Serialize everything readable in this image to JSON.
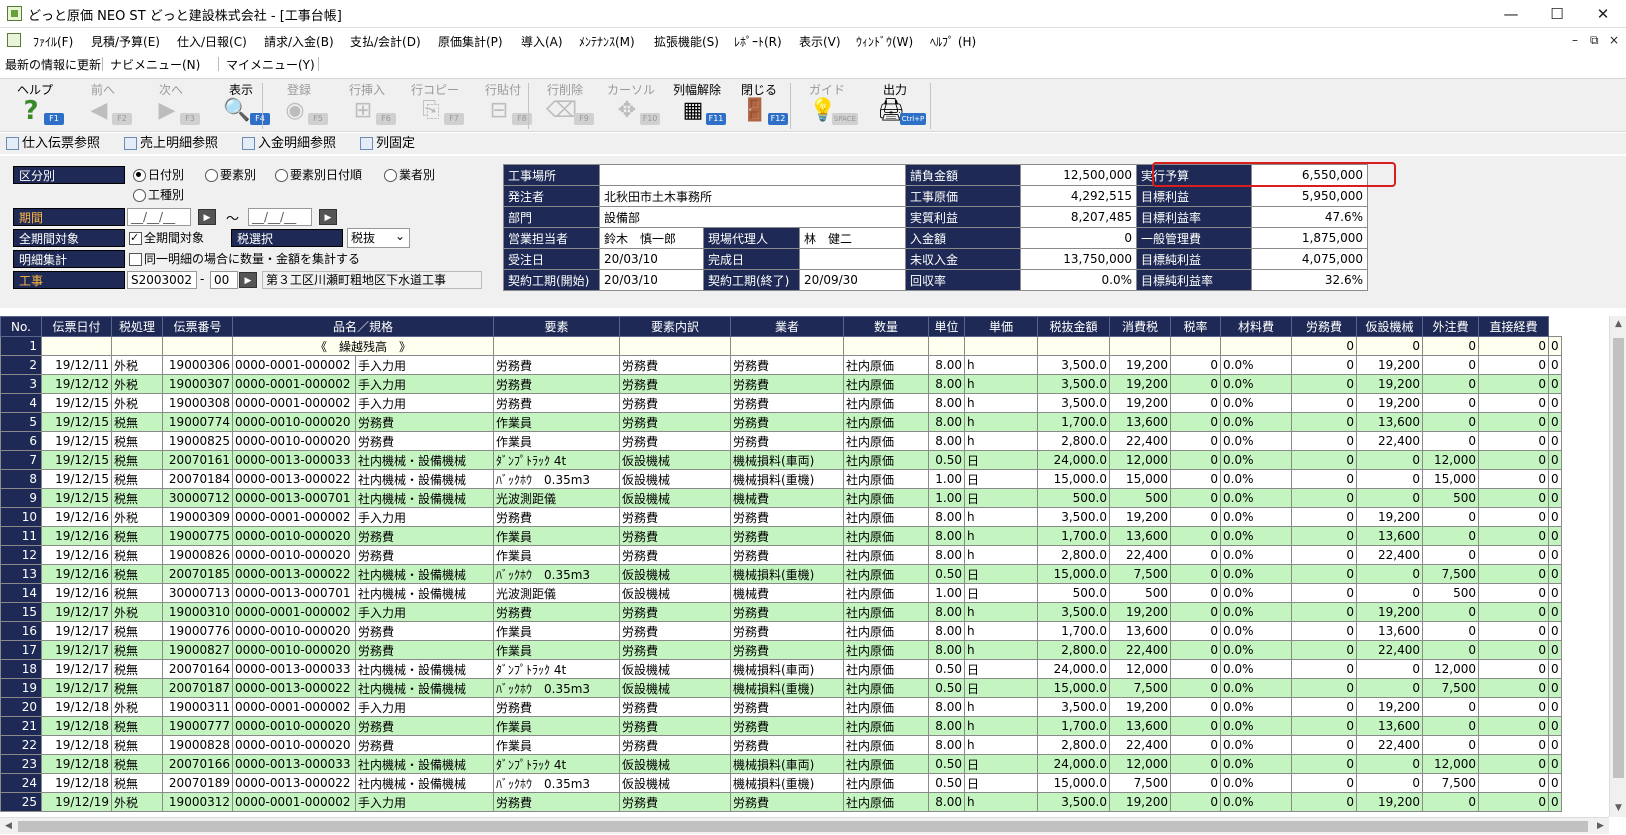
{
  "window": {
    "title": "どっと原価 NEO ST どっと建設株式会社 - [工事台帳]",
    "minimize": "—",
    "maximize": "☐",
    "close": "✕"
  },
  "menubar": {
    "items": [
      "ﾌｧｲﾙ(F)",
      "見積/予算(E)",
      "仕入/日報(C)",
      "請求/入金(B)",
      "支払/会計(D)",
      "原価集計(P)",
      "導入(A)",
      "ﾒﾝﾃﾅﾝｽ(M)",
      "拡張機能(S)",
      "ﾚﾎﾟｰﾄ(R)",
      "表示(V)",
      "ｳｨﾝﾄﾞｳ(W)",
      "ﾍﾙﾌﾟ (H)"
    ],
    "mdi_min": "–",
    "mdi_restore": "⧉",
    "mdi_close": "×"
  },
  "linkbar": {
    "items": [
      "最新の情報に更新",
      "ナビメニュー(N)",
      "マイメニュー(Y)"
    ]
  },
  "toolbar": {
    "buttons": [
      {
        "label": "ヘルプ",
        "key": "F1",
        "icon": "help-icon",
        "glyph": "?",
        "enabled": true
      },
      {
        "label": "前へ",
        "key": "F2",
        "icon": "back-arrow-icon",
        "glyph": "◀",
        "enabled": false
      },
      {
        "label": "次へ",
        "key": "F3",
        "icon": "forward-arrow-icon",
        "glyph": "▶",
        "enabled": false
      },
      {
        "label": "表示",
        "key": "F4",
        "icon": "magnifier-icon",
        "glyph": "🔍",
        "enabled": true
      },
      {
        "label": "登録",
        "key": "F5",
        "icon": "ok-icon",
        "glyph": "◉",
        "enabled": false
      },
      {
        "label": "行挿入",
        "key": "F6",
        "icon": "row-insert-icon",
        "glyph": "⊞",
        "enabled": false
      },
      {
        "label": "行コピー",
        "key": "F7",
        "icon": "row-copy-icon",
        "glyph": "⎘",
        "enabled": false
      },
      {
        "label": "行貼付",
        "key": "F8",
        "icon": "row-paste-icon",
        "glyph": "⊟",
        "enabled": false
      },
      {
        "label": "行削除",
        "key": "F9",
        "icon": "row-delete-icon",
        "glyph": "⌫",
        "enabled": false
      },
      {
        "label": "カーソル",
        "key": "F10",
        "icon": "cursor-icon",
        "glyph": "✥",
        "enabled": false
      },
      {
        "label": "列幅解除",
        "key": "F11",
        "icon": "column-width-icon",
        "glyph": "▦",
        "enabled": true
      },
      {
        "label": "閉じる",
        "key": "F12",
        "icon": "door-icon",
        "glyph": "🚪",
        "enabled": true
      },
      {
        "label": "ガイド",
        "key": "SPACE",
        "icon": "lightbulb-icon",
        "glyph": "💡",
        "enabled": false
      },
      {
        "label": "出力",
        "key": "Ctrl+P",
        "icon": "print-output-icon",
        "glyph": "🖨",
        "enabled": true
      }
    ]
  },
  "refbar": {
    "items": [
      "仕入伝票参照",
      "売上明細参照",
      "入金明細参照",
      "列固定"
    ]
  },
  "filter": {
    "kubun_label": "区分別",
    "kubun_options": [
      "日付別",
      "要素別",
      "要素別日付順",
      "業者別",
      "工種別"
    ],
    "kubun_selected": "日付別",
    "kikan_label": "期間",
    "date_placeholder": "__/__/__",
    "tilde": "～",
    "zenkikan_label": "全期間対象",
    "zenkikan_check": "全期間対象",
    "zei_select_label": "税選択",
    "zei_select_value": "税抜",
    "meisai_label": "明細集計",
    "meisai_check": "同一明細の場合に数量・金額を集計する",
    "kouji_label": "工事",
    "kouji_code": "S2003002",
    "kouji_dash": "-",
    "kouji_sub": "00",
    "kouji_name": "第３工区川瀬町粗地区下水道工事"
  },
  "info": {
    "rows": [
      {
        "h1": "工事場所",
        "v1": "",
        "h3": "請負金額",
        "v3": "12,500,000",
        "h4": "実行予算",
        "v4": "6,550,000"
      },
      {
        "h1": "発注者",
        "v1": "北秋田市土木事務所",
        "h3": "工事原価",
        "v3": "4,292,515",
        "h4": "目標利益",
        "v4": "5,950,000"
      },
      {
        "h1": "部門",
        "v1": "設備部",
        "h3": "実質利益",
        "v3": "8,207,485",
        "h4": "目標利益率",
        "v4": "47.6%"
      },
      {
        "h1": "営業担当者",
        "v1": "鈴木　慎一郎",
        "h2": "現場代理人",
        "v2": "林　健二",
        "h3": "入金額",
        "v3": "0",
        "h4": "一般管理費",
        "v4": "1,875,000"
      },
      {
        "h1": "受注日",
        "v1": "20/03/10",
        "h2": "完成日",
        "v2": "",
        "h3": "未収入金",
        "v3": "13,750,000",
        "h4": "目標純利益",
        "v4": "4,075,000"
      },
      {
        "h1": "契約工期(開始)",
        "v1": "20/03/10",
        "h2": "契約工期(終了)",
        "v2": "20/09/30",
        "h3": "回収率",
        "v3": "0.0%",
        "h4": "目標純利益率",
        "v4": "32.6%"
      }
    ]
  },
  "grid": {
    "headers": [
      "No.",
      "伝票日付",
      "税処理",
      "伝票番号",
      "品名／規格",
      "",
      "要素",
      "要素内訳",
      "業者",
      "数量",
      "単位",
      "単価",
      "税抜金額",
      "消費税",
      "税率",
      "材料費",
      "労務費",
      "仮設機械",
      "外注費",
      "直接経費"
    ],
    "carry_over": {
      "no": "1",
      "label": "《　繰越残高　》",
      "zairyo": "0",
      "romu": "0",
      "kasetsu": "0",
      "gaichu": "0",
      "chokusetsu": "0"
    },
    "rows": [
      [
        "2",
        "19/12/11",
        "外税",
        "19000306",
        "0000-0001-000002",
        "手入力用",
        "労務費",
        "労務費",
        "労務費",
        "社内原価",
        "8.00",
        "h",
        "3,500.0",
        "19,200",
        "0",
        "0.0%",
        "0",
        "19,200",
        "0",
        "0",
        "0"
      ],
      [
        "3",
        "19/12/12",
        "外税",
        "19000307",
        "0000-0001-000002",
        "手入力用",
        "労務費",
        "労務費",
        "労務費",
        "社内原価",
        "8.00",
        "h",
        "3,500.0",
        "19,200",
        "0",
        "0.0%",
        "0",
        "19,200",
        "0",
        "0",
        "0"
      ],
      [
        "4",
        "19/12/15",
        "外税",
        "19000308",
        "0000-0001-000002",
        "手入力用",
        "労務費",
        "労務費",
        "労務費",
        "社内原価",
        "8.00",
        "h",
        "3,500.0",
        "19,200",
        "0",
        "0.0%",
        "0",
        "19,200",
        "0",
        "0",
        "0"
      ],
      [
        "5",
        "19/12/15",
        "税無",
        "19000774",
        "0000-0010-000020",
        "労務費",
        "作業員",
        "労務費",
        "労務費",
        "社内原価",
        "8.00",
        "h",
        "1,700.0",
        "13,600",
        "0",
        "0.0%",
        "0",
        "13,600",
        "0",
        "0",
        "0"
      ],
      [
        "6",
        "19/12/15",
        "税無",
        "19000825",
        "0000-0010-000020",
        "労務費",
        "作業員",
        "労務費",
        "労務費",
        "社内原価",
        "8.00",
        "h",
        "2,800.0",
        "22,400",
        "0",
        "0.0%",
        "0",
        "22,400",
        "0",
        "0",
        "0"
      ],
      [
        "7",
        "19/12/15",
        "税無",
        "20070161",
        "0000-0013-000033",
        "社内機械・設備機械",
        "ﾀﾞﾝﾌﾟﾄﾗｯｸ 4t",
        "仮設機械",
        "機械損料(車両)",
        "社内原価",
        "0.50",
        "日",
        "24,000.0",
        "12,000",
        "0",
        "0.0%",
        "0",
        "0",
        "12,000",
        "0",
        "0"
      ],
      [
        "8",
        "19/12/15",
        "税無",
        "20070184",
        "0000-0013-000022",
        "社内機械・設備機械",
        "ﾊﾞｯｸﾎｳ　0.35m3",
        "仮設機械",
        "機械損料(重機)",
        "社内原価",
        "1.00",
        "日",
        "15,000.0",
        "15,000",
        "0",
        "0.0%",
        "0",
        "0",
        "15,000",
        "0",
        "0"
      ],
      [
        "9",
        "19/12/15",
        "税無",
        "30000712",
        "0000-0013-000701",
        "社内機械・設備機械",
        "光波測距儀",
        "仮設機械",
        "機械費",
        "社内原価",
        "1.00",
        "日",
        "500.0",
        "500",
        "0",
        "0.0%",
        "0",
        "0",
        "500",
        "0",
        "0"
      ],
      [
        "10",
        "19/12/16",
        "外税",
        "19000309",
        "0000-0001-000002",
        "手入力用",
        "労務費",
        "労務費",
        "労務費",
        "社内原価",
        "8.00",
        "h",
        "3,500.0",
        "19,200",
        "0",
        "0.0%",
        "0",
        "19,200",
        "0",
        "0",
        "0"
      ],
      [
        "11",
        "19/12/16",
        "税無",
        "19000775",
        "0000-0010-000020",
        "労務費",
        "作業員",
        "労務費",
        "労務費",
        "社内原価",
        "8.00",
        "h",
        "1,700.0",
        "13,600",
        "0",
        "0.0%",
        "0",
        "13,600",
        "0",
        "0",
        "0"
      ],
      [
        "12",
        "19/12/16",
        "税無",
        "19000826",
        "0000-0010-000020",
        "労務費",
        "作業員",
        "労務費",
        "労務費",
        "社内原価",
        "8.00",
        "h",
        "2,800.0",
        "22,400",
        "0",
        "0.0%",
        "0",
        "22,400",
        "0",
        "0",
        "0"
      ],
      [
        "13",
        "19/12/16",
        "税無",
        "20070185",
        "0000-0013-000022",
        "社内機械・設備機械",
        "ﾊﾞｯｸﾎｳ　0.35m3",
        "仮設機械",
        "機械損料(重機)",
        "社内原価",
        "0.50",
        "日",
        "15,000.0",
        "7,500",
        "0",
        "0.0%",
        "0",
        "0",
        "7,500",
        "0",
        "0"
      ],
      [
        "14",
        "19/12/16",
        "税無",
        "30000713",
        "0000-0013-000701",
        "社内機械・設備機械",
        "光波測距儀",
        "仮設機械",
        "機械費",
        "社内原価",
        "1.00",
        "日",
        "500.0",
        "500",
        "0",
        "0.0%",
        "0",
        "0",
        "500",
        "0",
        "0"
      ],
      [
        "15",
        "19/12/17",
        "外税",
        "19000310",
        "0000-0001-000002",
        "手入力用",
        "労務費",
        "労務費",
        "労務費",
        "社内原価",
        "8.00",
        "h",
        "3,500.0",
        "19,200",
        "0",
        "0.0%",
        "0",
        "19,200",
        "0",
        "0",
        "0"
      ],
      [
        "16",
        "19/12/17",
        "税無",
        "19000776",
        "0000-0010-000020",
        "労務費",
        "作業員",
        "労務費",
        "労務費",
        "社内原価",
        "8.00",
        "h",
        "1,700.0",
        "13,600",
        "0",
        "0.0%",
        "0",
        "13,600",
        "0",
        "0",
        "0"
      ],
      [
        "17",
        "19/12/17",
        "税無",
        "19000827",
        "0000-0010-000020",
        "労務費",
        "作業員",
        "労務費",
        "労務費",
        "社内原価",
        "8.00",
        "h",
        "2,800.0",
        "22,400",
        "0",
        "0.0%",
        "0",
        "22,400",
        "0",
        "0",
        "0"
      ],
      [
        "18",
        "19/12/17",
        "税無",
        "20070164",
        "0000-0013-000033",
        "社内機械・設備機械",
        "ﾀﾞﾝﾌﾟﾄﾗｯｸ 4t",
        "仮設機械",
        "機械損料(車両)",
        "社内原価",
        "0.50",
        "日",
        "24,000.0",
        "12,000",
        "0",
        "0.0%",
        "0",
        "0",
        "12,000",
        "0",
        "0"
      ],
      [
        "19",
        "19/12/17",
        "税無",
        "20070187",
        "0000-0013-000022",
        "社内機械・設備機械",
        "ﾊﾞｯｸﾎｳ　0.35m3",
        "仮設機械",
        "機械損料(重機)",
        "社内原価",
        "0.50",
        "日",
        "15,000.0",
        "7,500",
        "0",
        "0.0%",
        "0",
        "0",
        "7,500",
        "0",
        "0"
      ],
      [
        "20",
        "19/12/18",
        "外税",
        "19000311",
        "0000-0001-000002",
        "手入力用",
        "労務費",
        "労務費",
        "労務費",
        "社内原価",
        "8.00",
        "h",
        "3,500.0",
        "19,200",
        "0",
        "0.0%",
        "0",
        "19,200",
        "0",
        "0",
        "0"
      ],
      [
        "21",
        "19/12/18",
        "税無",
        "19000777",
        "0000-0010-000020",
        "労務費",
        "作業員",
        "労務費",
        "労務費",
        "社内原価",
        "8.00",
        "h",
        "1,700.0",
        "13,600",
        "0",
        "0.0%",
        "0",
        "13,600",
        "0",
        "0",
        "0"
      ],
      [
        "22",
        "19/12/18",
        "税無",
        "19000828",
        "0000-0010-000020",
        "労務費",
        "作業員",
        "労務費",
        "労務費",
        "社内原価",
        "8.00",
        "h",
        "2,800.0",
        "22,400",
        "0",
        "0.0%",
        "0",
        "22,400",
        "0",
        "0",
        "0"
      ],
      [
        "23",
        "19/12/18",
        "税無",
        "20070166",
        "0000-0013-000033",
        "社内機械・設備機械",
        "ﾀﾞﾝﾌﾟﾄﾗｯｸ 4t",
        "仮設機械",
        "機械損料(車両)",
        "社内原価",
        "0.50",
        "日",
        "24,000.0",
        "12,000",
        "0",
        "0.0%",
        "0",
        "0",
        "12,000",
        "0",
        "0"
      ],
      [
        "24",
        "19/12/18",
        "税無",
        "20070189",
        "0000-0013-000022",
        "社内機械・設備機械",
        "ﾊﾞｯｸﾎｳ　0.35m3",
        "仮設機械",
        "機械損料(重機)",
        "社内原価",
        "0.50",
        "日",
        "15,000.0",
        "7,500",
        "0",
        "0.0%",
        "0",
        "0",
        "7,500",
        "0",
        "0"
      ],
      [
        "25",
        "19/12/19",
        "外税",
        "19000312",
        "0000-0001-000002",
        "手入力用",
        "労務費",
        "労務費",
        "労務費",
        "社内原価",
        "8.00",
        "h",
        "3,500.0",
        "19,200",
        "0",
        "0.0%",
        "0",
        "19,200",
        "0",
        "0",
        "0"
      ]
    ]
  }
}
